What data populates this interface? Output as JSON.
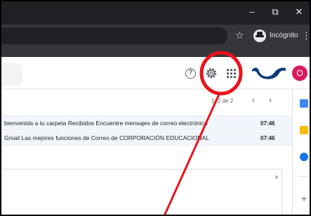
{
  "window": {
    "controls": {
      "minimize": "–",
      "maximize": "⧉",
      "close": "✕"
    }
  },
  "addressbar": {
    "bookmark_star": "☆",
    "incognito_label": "Incógnito",
    "menu_dots": "⋮"
  },
  "header": {
    "help_glyph": "?",
    "avatar_initial": "O"
  },
  "toolbar": {
    "pager_text": "1–2 de 2",
    "prev": "‹",
    "next": "›"
  },
  "messages": [
    {
      "snippet": "bienvenida a tu carpeta Recibidos Encuentre mensajes de correo electrónico",
      "time": "07:46"
    },
    {
      "snippet": "Gmail Las mejores funciones de Correo de CORPORACIÓN EDUCACIONAL",
      "time": "07:46"
    }
  ],
  "promo": {
    "close": "×"
  },
  "side_panel": {
    "add": "+"
  },
  "colors": {
    "title_bar": "#202124",
    "address_bar": "#35363a",
    "annotation_red": "#e8141e",
    "avatar": "#d81b60",
    "brand_logo": "#0a3a78"
  },
  "icons": [
    "gear-icon",
    "apps-grid-icon",
    "help-icon",
    "star-icon",
    "incognito-icon"
  ]
}
